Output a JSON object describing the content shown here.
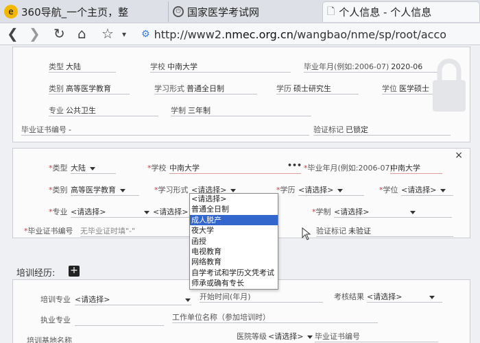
{
  "browser": {
    "tabs": [
      {
        "label": "360导航_一个主页，整"
      },
      {
        "label": "国家医学考试网"
      },
      {
        "label": "个人信息 - 个人信息"
      }
    ],
    "url_prefix": "http://www2.",
    "url_domain": "nmec.org.cn",
    "url_path": "/wangbao/nme/sp/root/acco"
  },
  "readonly_panel": {
    "rows": [
      {
        "label": "类型",
        "value": "大陆"
      },
      {
        "label": "学校",
        "value": "中南大学"
      },
      {
        "label": "毕业年月(例如:2006-07)",
        "value": "2020-06"
      },
      {
        "label": "类别",
        "value": "高等医学教育"
      },
      {
        "label": "学习形式",
        "value": "普通全日制"
      },
      {
        "label": "学历",
        "value": "硕士研究生"
      },
      {
        "label": "学位",
        "value": "医学硕士"
      },
      {
        "label": "专业",
        "value": "公共卫生"
      },
      {
        "label": "学制",
        "value": "三年制"
      },
      {
        "label": "毕业证书编号",
        "value": "-"
      },
      {
        "label": "验证标记",
        "value": "已锁定"
      }
    ]
  },
  "edit_panel": {
    "type": {
      "label": "类型",
      "value": "大陆"
    },
    "school": {
      "label": "学校",
      "value": "中南大学",
      "more": "•••"
    },
    "grad": {
      "label": "毕业年月(例如:2006-07)",
      "value": "中南大学"
    },
    "category": {
      "label": "类别",
      "value": "高等医学教育"
    },
    "study_form": {
      "label": "学习形式",
      "value": "<请选择>"
    },
    "degree_level": {
      "label": "学历",
      "value": "<请选择>"
    },
    "degree": {
      "label": "学位",
      "value": "<请选择>"
    },
    "major": {
      "label": "专业",
      "value": "<请选择>",
      "value2": "<请选择>"
    },
    "duration": {
      "label": "学制",
      "value": "<请选择>"
    },
    "cert_no": {
      "label": "毕业证书编号",
      "placeholder": "无毕业证时填\"-\""
    },
    "verify": {
      "label": "验证标记",
      "value": "未验证"
    },
    "close": "×"
  },
  "dropdown": {
    "options": [
      "<请选择>",
      "普通全日制",
      "成人脱产",
      "夜大学",
      "函授",
      "电视教育",
      "网络教育",
      "自学考试和学历文凭考试",
      "师承或确有专长"
    ],
    "highlighted": 2
  },
  "training": {
    "title": "培训经历:",
    "add": "+",
    "major": {
      "label": "培训专业",
      "value": "<请选择>"
    },
    "start": {
      "label": "开始时间(年月)"
    },
    "result": {
      "label": "考核结果",
      "value": "<请选择>"
    },
    "job_major": {
      "label": "执业专业"
    },
    "work_unit": {
      "label": "工作单位名称（参加培训时）"
    },
    "base": {
      "label": "培训基地名称"
    },
    "hospital_level": {
      "label": "医院等级",
      "value": "<请选择>"
    },
    "cert": {
      "label": "毕业证书编号"
    }
  },
  "colors": {
    "accent": "#3366cc",
    "required": "#dd3333"
  }
}
